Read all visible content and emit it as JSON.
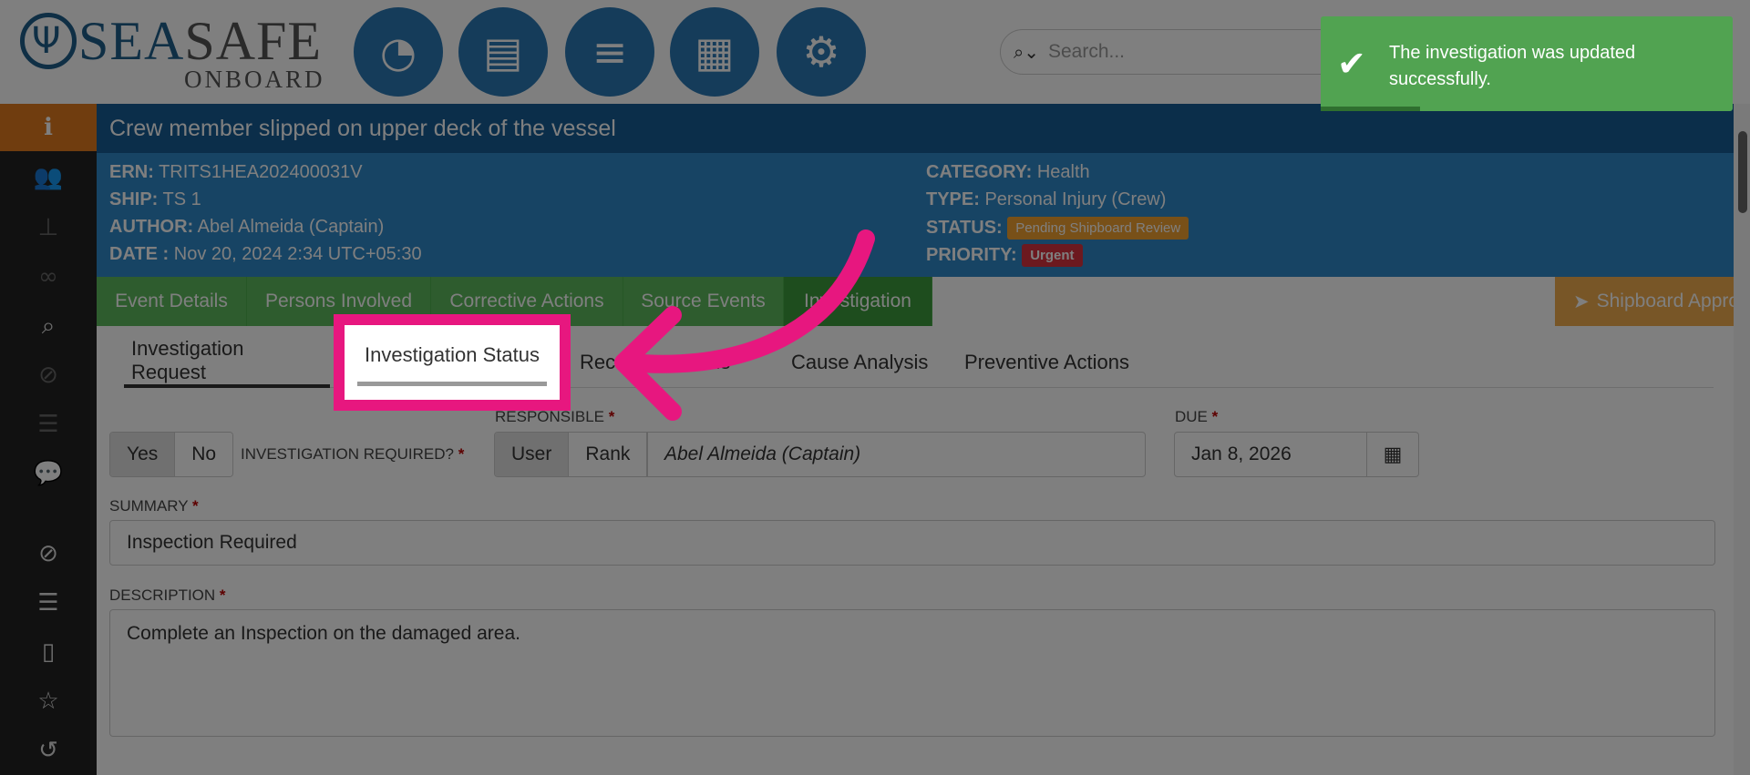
{
  "logo": {
    "sea": "SEA",
    "safe": "SAFE",
    "onboard": "ONBOARD"
  },
  "nav_icons": [
    "dashboard-icon",
    "book-icon",
    "menu-icon",
    "calendar-icon",
    "settings-icon"
  ],
  "search": {
    "placeholder": "Search..."
  },
  "toast": {
    "message": "The investigation was updated successfully."
  },
  "sidebar": {
    "items": [
      "info-icon",
      "users-icon",
      "hierarchy-icon",
      "link-icon",
      "search-icon",
      "paperclip-icon",
      "list-icon",
      "comments-icon",
      "paperclip-icon",
      "server-icon",
      "document-icon",
      "star-icon",
      "history-icon"
    ]
  },
  "event": {
    "title": "Crew member slipped on upper deck of the vessel",
    "ern_label": "ERN:",
    "ern": "TRITS1HEA202400031V",
    "ship_label": "SHIP:",
    "ship": "TS 1",
    "author_label": "AUTHOR:",
    "author": "Abel Almeida (Captain)",
    "date_label": "DATE :",
    "date": "Nov 20, 2024 2:34 UTC+05:30",
    "category_label": "CATEGORY:",
    "category": "Health",
    "type_label": "TYPE:",
    "type": "Personal Injury (Crew)",
    "status_label": "STATUS:",
    "status": "Pending Shipboard Review",
    "priority_label": "PRIORITY:",
    "priority": "Urgent"
  },
  "tabs": [
    "Event Details",
    "Persons Involved",
    "Corrective Actions",
    "Source Events",
    "Investigation"
  ],
  "approval": {
    "label": "Shipboard Approval"
  },
  "subtabs": [
    "Investigation Request",
    "Investigation Status",
    "Rec",
    "ns",
    "Cause Analysis",
    "Preventive Actions"
  ],
  "form": {
    "yes": "Yes",
    "no": "No",
    "investigation_required_label": "INVESTIGATION REQUIRED?",
    "responsible_label": "RESPONSIBLE",
    "user": "User",
    "rank": "Rank",
    "responsible_value": "Abel Almeida (Captain)",
    "due_label": "DUE",
    "due_value": "Jan 8, 2026",
    "summary_label": "SUMMARY",
    "summary_value": "Inspection Required",
    "description_label": "DESCRIPTION",
    "description_value": "Complete an Inspection on the damaged area."
  },
  "colors": {
    "primary": "#2b78b4",
    "title": "#175d95",
    "tabs": "#5cb85c",
    "accent": "#e07a1f",
    "highlight": "#e7177f"
  }
}
